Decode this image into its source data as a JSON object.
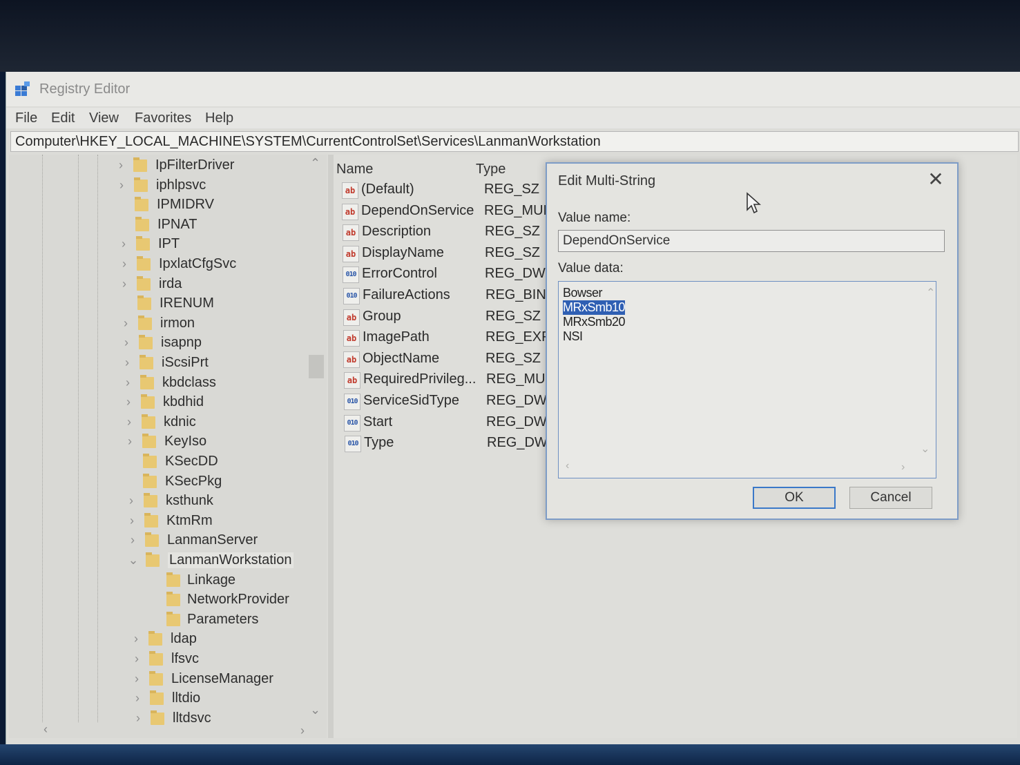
{
  "window": {
    "title": "Registry Editor"
  },
  "menu": [
    "File",
    "Edit",
    "View",
    "Favorites",
    "Help"
  ],
  "address": "Computer\\HKEY_LOCAL_MACHINE\\SYSTEM\\CurrentControlSet\\Services\\LanmanWorkstation",
  "tree": {
    "items": [
      {
        "label": "IpFilterDriver",
        "expandable": true
      },
      {
        "label": "iphlpsvc",
        "expandable": true
      },
      {
        "label": "IPMIDRV",
        "expandable": false
      },
      {
        "label": "IPNAT",
        "expandable": false
      },
      {
        "label": "IPT",
        "expandable": true
      },
      {
        "label": "IpxlatCfgSvc",
        "expandable": true
      },
      {
        "label": "irda",
        "expandable": true
      },
      {
        "label": "IRENUM",
        "expandable": false
      },
      {
        "label": "irmon",
        "expandable": true
      },
      {
        "label": "isapnp",
        "expandable": true
      },
      {
        "label": "iScsiPrt",
        "expandable": true
      },
      {
        "label": "kbdclass",
        "expandable": true
      },
      {
        "label": "kbdhid",
        "expandable": true
      },
      {
        "label": "kdnic",
        "expandable": true
      },
      {
        "label": "KeyIso",
        "expandable": true
      },
      {
        "label": "KSecDD",
        "expandable": false
      },
      {
        "label": "KSecPkg",
        "expandable": false
      },
      {
        "label": "ksthunk",
        "expandable": true
      },
      {
        "label": "KtmRm",
        "expandable": true
      },
      {
        "label": "LanmanServer",
        "expandable": true
      },
      {
        "label": "LanmanWorkstation",
        "expandable": true,
        "expanded": true,
        "selected": true
      },
      {
        "label": "Linkage",
        "child": true
      },
      {
        "label": "NetworkProvider",
        "child": true
      },
      {
        "label": "Parameters",
        "child": true
      },
      {
        "label": "ldap",
        "expandable": true
      },
      {
        "label": "lfsvc",
        "expandable": true
      },
      {
        "label": "LicenseManager",
        "expandable": true
      },
      {
        "label": "lltdio",
        "expandable": true
      },
      {
        "label": "lltdsvc",
        "expandable": true
      }
    ]
  },
  "values": {
    "headers": {
      "name": "Name",
      "type": "Type"
    },
    "rows": [
      {
        "icon": "string-value-icon",
        "name": "(Default)",
        "type": "REG_SZ"
      },
      {
        "icon": "string-value-icon",
        "name": "DependOnService",
        "type": "REG_MULTI_"
      },
      {
        "icon": "string-value-icon",
        "name": "Description",
        "type": "REG_SZ"
      },
      {
        "icon": "string-value-icon",
        "name": "DisplayName",
        "type": "REG_SZ"
      },
      {
        "icon": "binary-value-icon",
        "name": "ErrorControl",
        "type": "REG_DWOR"
      },
      {
        "icon": "binary-value-icon",
        "name": "FailureActions",
        "type": "REG_BINAR"
      },
      {
        "icon": "string-value-icon",
        "name": "Group",
        "type": "REG_SZ"
      },
      {
        "icon": "string-value-icon",
        "name": "ImagePath",
        "type": "REG_EXPAN"
      },
      {
        "icon": "string-value-icon",
        "name": "ObjectName",
        "type": "REG_SZ"
      },
      {
        "icon": "string-value-icon",
        "name": "RequiredPrivileg...",
        "type": "REG_MULTI_"
      },
      {
        "icon": "binary-value-icon",
        "name": "ServiceSidType",
        "type": "REG_DWOR"
      },
      {
        "icon": "binary-value-icon",
        "name": "Start",
        "type": "REG_DWOR"
      },
      {
        "icon": "binary-value-icon",
        "name": "Type",
        "type": "REG_DWOR"
      }
    ]
  },
  "dialog": {
    "title": "Edit Multi-String",
    "close_glyph": "✕",
    "value_name_label": "Value name:",
    "value_name": "DependOnService",
    "value_data_label": "Value data:",
    "value_data_lines": [
      "Bowser",
      "MRxSmb10",
      "MRxSmb20",
      "NSI"
    ],
    "selected_line_index": 1,
    "ok_label": "OK",
    "cancel_label": "Cancel"
  },
  "colors": {
    "selection": "#2f5fb3",
    "folder": "#e8c872",
    "dialog_border": "#7d9cc7"
  }
}
